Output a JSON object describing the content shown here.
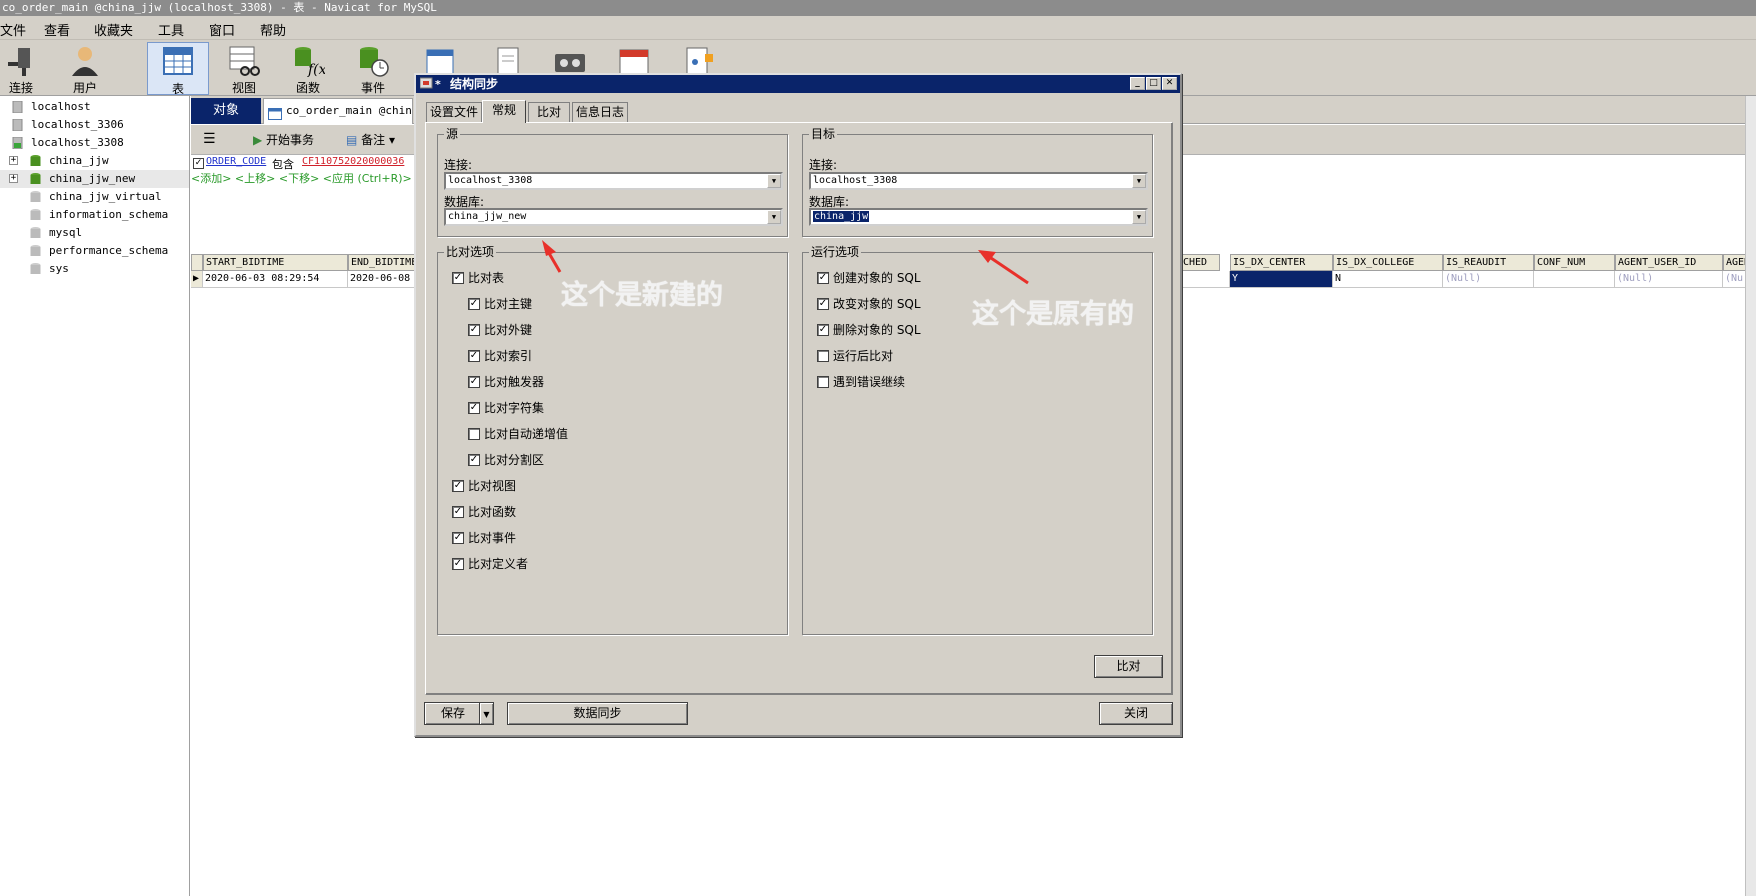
{
  "window": {
    "title": "co_order_main @china_jjw (localhost_3308) - 表 - Navicat for MySQL"
  },
  "menu": [
    "文件",
    "查看",
    "收藏夹",
    "工具",
    "窗口",
    "帮助"
  ],
  "toolbar": {
    "items": [
      "连接",
      "用户",
      "表",
      "视图",
      "函数",
      "事件"
    ]
  },
  "tree": {
    "items": [
      "localhost",
      "localhost_3306",
      "localhost_3308",
      "china_jjw",
      "china_jjw_new",
      "china_jjw_virtual",
      "information_schema",
      "mysql",
      "performance_schema",
      "sys"
    ]
  },
  "main": {
    "tab_objects": "对象",
    "tab_table": "co_order_main @china_j",
    "begin_tx": "开始事务",
    "memo": "备注",
    "filter": {
      "field": "ORDER_CODE",
      "op": "包含",
      "value": "CF110752020000036",
      "actions": "<添加> <上移> <下移> <应用 (Ctrl+R)>"
    },
    "grid": {
      "headers_left": [
        "START_BIDTIME",
        "END_BIDTIME"
      ],
      "row_left": [
        "2020-06-03 08:29:54",
        "2020-06-08"
      ],
      "headers_right": [
        "CHED",
        "IS_DX_CENTER",
        "IS_DX_COLLEGE",
        "IS_REAUDIT",
        "CONF_NUM",
        "AGENT_USER_ID",
        "AGEN"
      ],
      "row_right": [
        "",
        "Y",
        "N",
        "(Null)",
        "",
        "(Null)",
        "(Nu"
      ]
    }
  },
  "dialog": {
    "title": "结构同步",
    "tabs": [
      "设置文件",
      "常规",
      "比对",
      "信息日志"
    ],
    "active_tab": "常规",
    "source": {
      "legend": "源",
      "conn_label": "连接:",
      "conn_value": "localhost_3308",
      "db_label": "数据库:",
      "db_value": "china_jjw_new"
    },
    "target": {
      "legend": "目标",
      "conn_label": "连接:",
      "conn_value": "localhost_3308",
      "db_label": "数据库:",
      "db_value": "china_jjw"
    },
    "compare_options": {
      "legend": "比对选项",
      "items": [
        {
          "label": "比对表",
          "checked": true
        },
        {
          "label": "比对主键",
          "checked": true
        },
        {
          "label": "比对外键",
          "checked": true
        },
        {
          "label": "比对索引",
          "checked": true
        },
        {
          "label": "比对触发器",
          "checked": true
        },
        {
          "label": "比对字符集",
          "checked": true
        },
        {
          "label": "比对自动递增值",
          "checked": false
        },
        {
          "label": "比对分割区",
          "checked": true
        },
        {
          "label": "比对视图",
          "checked": true
        },
        {
          "label": "比对函数",
          "checked": true
        },
        {
          "label": "比对事件",
          "checked": true
        },
        {
          "label": "比对定义者",
          "checked": true
        }
      ]
    },
    "run_options": {
      "legend": "运行选项",
      "items": [
        {
          "label": "创建对象的 SQL",
          "checked": true
        },
        {
          "label": "改变对象的 SQL",
          "checked": true
        },
        {
          "label": "删除对象的 SQL",
          "checked": true
        },
        {
          "label": "运行后比对",
          "checked": false
        },
        {
          "label": "遇到错误继续",
          "checked": false
        }
      ]
    },
    "compare_button": "比对",
    "save_button": "保存",
    "sync_button": "数据同步",
    "close_button": "关闭"
  },
  "annotations": {
    "source_note": "这个是新建的",
    "target_note": "这个是原有的",
    "arrow_color": "#e8302a"
  }
}
